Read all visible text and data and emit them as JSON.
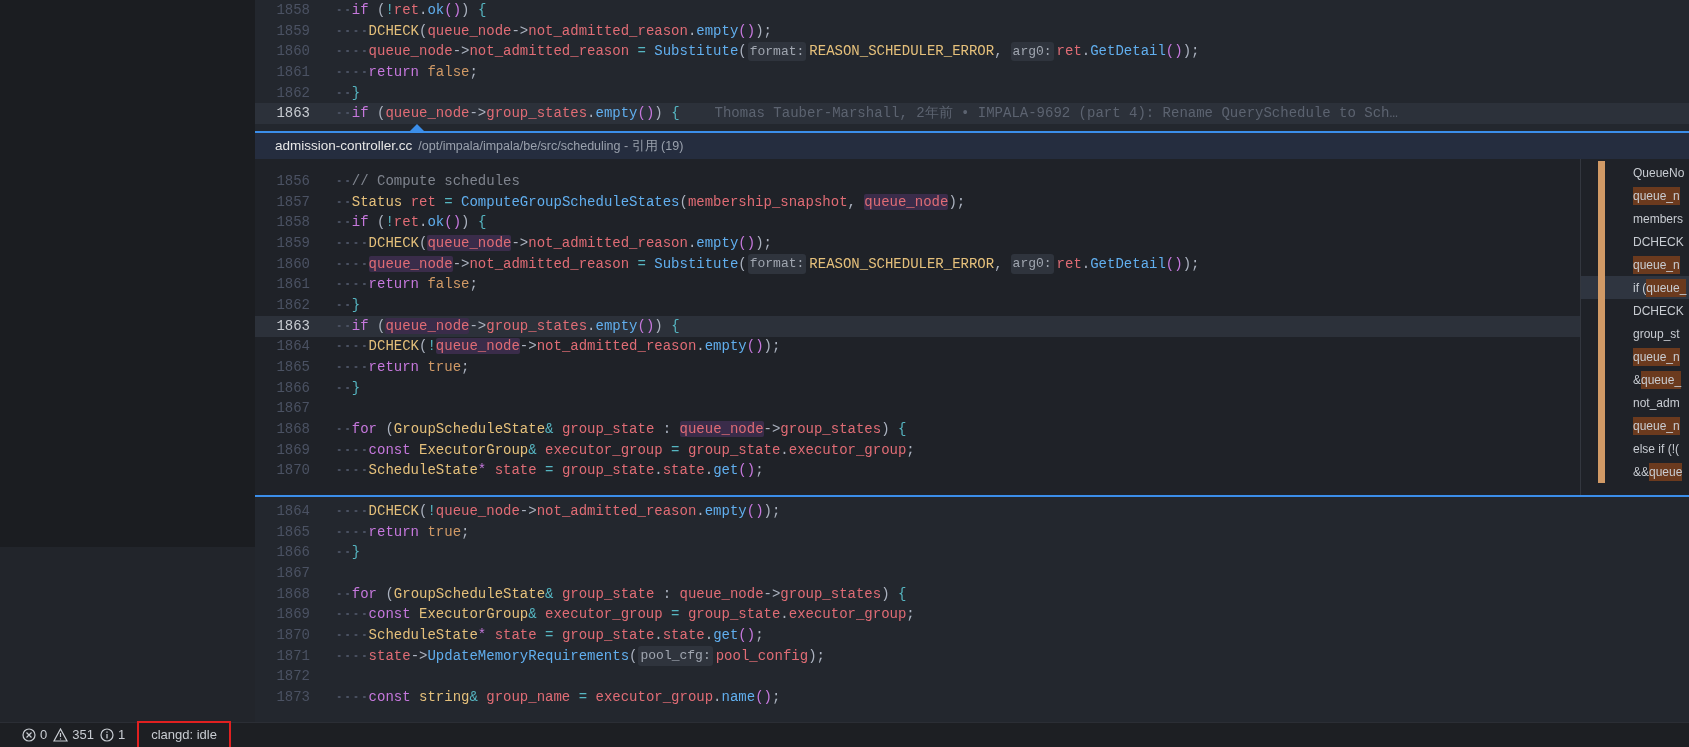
{
  "editor_top": {
    "lines": [
      {
        "number": "1858",
        "current": false,
        "segments": [
          {
            "kind": "code",
            "tokens": [
              {
                "text": "  if",
                "kind": "kw"
              },
              {
                "text": " (",
                "kind": "p"
              },
              {
                "text": "!",
                "kind": "op"
              },
              {
                "text": "ret",
                "kind": "var"
              },
              {
                "text": ".",
                "kind": "p"
              },
              {
                "text": "ok",
                "kind": "fn"
              },
              {
                "text": "()",
                "kind": "p2"
              },
              {
                "text": ")",
                "kind": "p"
              },
              {
                "text": " {",
                "kind": "b"
              }
            ]
          }
        ]
      },
      {
        "number": "1859",
        "current": false,
        "segments": [
          {
            "kind": "code",
            "tokens": [
              {
                "text": "    DCHECK",
                "kind": "mac"
              },
              {
                "text": "(",
                "kind": "p"
              },
              {
                "text": "queue_node",
                "kind": "var"
              },
              {
                "text": "->",
                "kind": "p"
              },
              {
                "text": "not_admitted_reason",
                "kind": "var"
              },
              {
                "text": ".",
                "kind": "p"
              },
              {
                "text": "empty",
                "kind": "fn"
              },
              {
                "text": "()",
                "kind": "p2"
              },
              {
                "text": ");",
                "kind": "p"
              }
            ]
          }
        ]
      },
      {
        "number": "1860",
        "current": false,
        "segments": [
          {
            "kind": "code",
            "tokens": [
              {
                "text": "    queue_node",
                "kind": "var"
              },
              {
                "text": "->",
                "kind": "p"
              },
              {
                "text": "not_admitted_reason",
                "kind": "var"
              },
              {
                "text": " = ",
                "kind": "op"
              },
              {
                "text": "Substitute",
                "kind": "fn"
              },
              {
                "text": "(",
                "kind": "p"
              }
            ]
          },
          {
            "kind": "hint",
            "text": "format:"
          },
          {
            "kind": "code",
            "tokens": [
              {
                "text": "REASON_SCHEDULER_ERROR",
                "kind": "type"
              },
              {
                "text": ",",
                "kind": "p"
              }
            ]
          },
          {
            "kind": "hint",
            "text": "arg0:"
          },
          {
            "kind": "code",
            "tokens": [
              {
                "text": "ret",
                "kind": "var"
              },
              {
                "text": ".",
                "kind": "p"
              },
              {
                "text": "GetDetail",
                "kind": "fn"
              },
              {
                "text": "()",
                "kind": "p2"
              },
              {
                "text": ");",
                "kind": "p"
              }
            ]
          }
        ]
      },
      {
        "number": "1861",
        "current": false,
        "segments": [
          {
            "kind": "code",
            "tokens": [
              {
                "text": "    return",
                "kind": "kw"
              },
              {
                "text": " false",
                "kind": "lit"
              },
              {
                "text": ";",
                "kind": "p"
              }
            ]
          }
        ]
      },
      {
        "number": "1862",
        "current": false,
        "segments": [
          {
            "kind": "code",
            "tokens": [
              {
                "text": "  }",
                "kind": "b"
              }
            ]
          }
        ]
      },
      {
        "number": "1863",
        "current": true,
        "segments": [
          {
            "kind": "code",
            "tokens": [
              {
                "text": "  if",
                "kind": "kw"
              },
              {
                "text": " (",
                "kind": "p"
              },
              {
                "text": "queue_node",
                "kind": "var"
              },
              {
                "text": "->",
                "kind": "p"
              },
              {
                "text": "group_states",
                "kind": "var"
              },
              {
                "text": ".",
                "kind": "p"
              },
              {
                "text": "empty",
                "kind": "fn"
              },
              {
                "text": "()",
                "kind": "p2"
              },
              {
                "text": ")",
                "kind": "p"
              },
              {
                "text": " {",
                "kind": "b"
              }
            ]
          }
        ],
        "blame": "Thomas Tauber-Marshall, 2年前 • IMPALA-9692 (part 4): Rename QuerySchedule to Sch…"
      }
    ]
  },
  "peek": {
    "file": "admission-controller.cc",
    "path": "/opt/impala/impala/be/src/scheduling - 引用 (19)",
    "lines": [
      {
        "number": "1856",
        "current": false,
        "segments": [
          {
            "kind": "code",
            "tokens": [
              {
                "text": "  // Compute schedules",
                "kind": "cm"
              }
            ]
          }
        ]
      },
      {
        "number": "1857",
        "current": false,
        "segments": [
          {
            "kind": "code",
            "tokens": [
              {
                "text": "  Status",
                "kind": "type"
              },
              {
                "text": " ret",
                "kind": "var"
              },
              {
                "text": " = ",
                "kind": "op"
              },
              {
                "text": "ComputeGroupScheduleStates",
                "kind": "fn"
              },
              {
                "text": "(",
                "kind": "p"
              },
              {
                "text": "membership_snapshot",
                "kind": "var"
              },
              {
                "text": ", ",
                "kind": "p"
              },
              {
                "text": "queue_node",
                "kind": "vhl"
              },
              {
                "text": ");",
                "kind": "p"
              }
            ]
          }
        ]
      },
      {
        "number": "1858",
        "current": false,
        "segments": [
          {
            "kind": "code",
            "tokens": [
              {
                "text": "  if",
                "kind": "kw"
              },
              {
                "text": " (",
                "kind": "p"
              },
              {
                "text": "!",
                "kind": "op"
              },
              {
                "text": "ret",
                "kind": "var"
              },
              {
                "text": ".",
                "kind": "p"
              },
              {
                "text": "ok",
                "kind": "fn"
              },
              {
                "text": "()",
                "kind": "p2"
              },
              {
                "text": ")",
                "kind": "p"
              },
              {
                "text": " {",
                "kind": "b"
              }
            ]
          }
        ]
      },
      {
        "number": "1859",
        "current": false,
        "segments": [
          {
            "kind": "code",
            "tokens": [
              {
                "text": "    DCHECK",
                "kind": "mac"
              },
              {
                "text": "(",
                "kind": "p"
              },
              {
                "text": "queue_node",
                "kind": "vhl"
              },
              {
                "text": "->",
                "kind": "p"
              },
              {
                "text": "not_admitted_reason",
                "kind": "var"
              },
              {
                "text": ".",
                "kind": "p"
              },
              {
                "text": "empty",
                "kind": "fn"
              },
              {
                "text": "()",
                "kind": "p2"
              },
              {
                "text": ");",
                "kind": "p"
              }
            ]
          }
        ]
      },
      {
        "number": "1860",
        "current": false,
        "segments": [
          {
            "kind": "code",
            "tokens": [
              {
                "text": "    queue_node",
                "kind": "vhl"
              },
              {
                "text": "->",
                "kind": "p"
              },
              {
                "text": "not_admitted_reason",
                "kind": "var"
              },
              {
                "text": " = ",
                "kind": "op"
              },
              {
                "text": "Substitute",
                "kind": "fn"
              },
              {
                "text": "(",
                "kind": "p"
              }
            ]
          },
          {
            "kind": "hint",
            "text": "format:"
          },
          {
            "kind": "code",
            "tokens": [
              {
                "text": "REASON_SCHEDULER_ERROR",
                "kind": "type"
              },
              {
                "text": ",",
                "kind": "p"
              }
            ]
          },
          {
            "kind": "hint",
            "text": "arg0:"
          },
          {
            "kind": "code",
            "tokens": [
              {
                "text": "ret",
                "kind": "var"
              },
              {
                "text": ".",
                "kind": "p"
              },
              {
                "text": "GetDetail",
                "kind": "fn"
              },
              {
                "text": "()",
                "kind": "p2"
              },
              {
                "text": ");",
                "kind": "p"
              }
            ]
          }
        ]
      },
      {
        "number": "1861",
        "current": false,
        "segments": [
          {
            "kind": "code",
            "tokens": [
              {
                "text": "    return",
                "kind": "kw"
              },
              {
                "text": " false",
                "kind": "lit"
              },
              {
                "text": ";",
                "kind": "p"
              }
            ]
          }
        ]
      },
      {
        "number": "1862",
        "current": false,
        "segments": [
          {
            "kind": "code",
            "tokens": [
              {
                "text": "  }",
                "kind": "b"
              }
            ]
          }
        ]
      },
      {
        "number": "1863",
        "current": true,
        "segments": [
          {
            "kind": "code",
            "tokens": [
              {
                "text": "  if",
                "kind": "kw"
              },
              {
                "text": " (",
                "kind": "p"
              },
              {
                "text": "queue_node",
                "kind": "vhl"
              },
              {
                "text": "->",
                "kind": "p"
              },
              {
                "text": "group_states",
                "kind": "var"
              },
              {
                "text": ".",
                "kind": "p"
              },
              {
                "text": "empty",
                "kind": "fn"
              },
              {
                "text": "()",
                "kind": "p2"
              },
              {
                "text": ")",
                "kind": "p"
              },
              {
                "text": " {",
                "kind": "b"
              }
            ]
          }
        ]
      },
      {
        "number": "1864",
        "current": false,
        "segments": [
          {
            "kind": "code",
            "tokens": [
              {
                "text": "    DCHECK",
                "kind": "mac"
              },
              {
                "text": "(",
                "kind": "p"
              },
              {
                "text": "!",
                "kind": "op"
              },
              {
                "text": "queue_node",
                "kind": "vhl"
              },
              {
                "text": "->",
                "kind": "p"
              },
              {
                "text": "not_admitted_reason",
                "kind": "var"
              },
              {
                "text": ".",
                "kind": "p"
              },
              {
                "text": "empty",
                "kind": "fn"
              },
              {
                "text": "()",
                "kind": "p2"
              },
              {
                "text": ");",
                "kind": "p"
              }
            ]
          }
        ]
      },
      {
        "number": "1865",
        "current": false,
        "segments": [
          {
            "kind": "code",
            "tokens": [
              {
                "text": "    return",
                "kind": "kw"
              },
              {
                "text": " true",
                "kind": "lit"
              },
              {
                "text": ";",
                "kind": "p"
              }
            ]
          }
        ]
      },
      {
        "number": "1866",
        "current": false,
        "segments": [
          {
            "kind": "code",
            "tokens": [
              {
                "text": "  }",
                "kind": "b"
              }
            ]
          }
        ]
      },
      {
        "number": "1867",
        "current": false
      },
      {
        "number": "1868",
        "current": false,
        "segments": [
          {
            "kind": "code",
            "tokens": [
              {
                "text": "  for",
                "kind": "kw"
              },
              {
                "text": " (",
                "kind": "p"
              },
              {
                "text": "GroupScheduleState",
                "kind": "type"
              },
              {
                "text": "&",
                "kind": "op"
              },
              {
                "text": " group_state",
                "kind": "var"
              },
              {
                "text": " : ",
                "kind": "p"
              },
              {
                "text": "queue_node",
                "kind": "vhl"
              },
              {
                "text": "->",
                "kind": "p"
              },
              {
                "text": "group_states",
                "kind": "var"
              },
              {
                "text": ")",
                "kind": "p"
              },
              {
                "text": " {",
                "kind": "b"
              }
            ]
          }
        ]
      },
      {
        "number": "1869",
        "current": false,
        "segments": [
          {
            "kind": "code",
            "tokens": [
              {
                "text": "    const",
                "kind": "kw"
              },
              {
                "text": " ExecutorGroup",
                "kind": "type"
              },
              {
                "text": "&",
                "kind": "op"
              },
              {
                "text": " executor_group",
                "kind": "var"
              },
              {
                "text": " = ",
                "kind": "op"
              },
              {
                "text": "group_state",
                "kind": "var"
              },
              {
                "text": ".",
                "kind": "p"
              },
              {
                "text": "executor_group",
                "kind": "var"
              },
              {
                "text": ";",
                "kind": "p"
              }
            ]
          }
        ]
      },
      {
        "number": "1870",
        "current": false,
        "segments": [
          {
            "kind": "code",
            "tokens": [
              {
                "text": "    ScheduleState",
                "kind": "type"
              },
              {
                "text": "*",
                "kind": "kw"
              },
              {
                "text": " state",
                "kind": "var"
              },
              {
                "text": " = ",
                "kind": "op"
              },
              {
                "text": "group_state",
                "kind": "var"
              },
              {
                "text": ".",
                "kind": "p"
              },
              {
                "text": "state",
                "kind": "var"
              },
              {
                "text": ".",
                "kind": "p"
              },
              {
                "text": "get",
                "kind": "fn"
              },
              {
                "text": "()",
                "kind": "p2"
              },
              {
                "text": ";",
                "kind": "p"
              }
            ]
          }
        ]
      }
    ],
    "references": [
      {
        "before": "QueueNo",
        "selected": false
      },
      {
        "match": "queue_n",
        "selected": false
      },
      {
        "before": "members",
        "selected": false
      },
      {
        "before": "DCHECK",
        "selected": false
      },
      {
        "match": "queue_n",
        "selected": false
      },
      {
        "before": "if (",
        "match": "queue_",
        "selected": true
      },
      {
        "before": "DCHECK",
        "selected": false
      },
      {
        "before": "group_st",
        "selected": false
      },
      {
        "match": "queue_n",
        "selected": false
      },
      {
        "before": "&",
        "match": "queue_",
        "selected": false
      },
      {
        "before": "not_adm",
        "selected": false
      },
      {
        "match": "queue_n",
        "selected": false
      },
      {
        "before": "else if (!(",
        "selected": false
      },
      {
        "before": "&&",
        "match": "queue",
        "selected": false
      }
    ]
  },
  "editor_bottom": {
    "lines": [
      {
        "number": "1864",
        "current": false,
        "segments": [
          {
            "kind": "code",
            "tokens": [
              {
                "text": "    DCHECK",
                "kind": "mac"
              },
              {
                "text": "(",
                "kind": "p"
              },
              {
                "text": "!",
                "kind": "op"
              },
              {
                "text": "queue_node",
                "kind": "var"
              },
              {
                "text": "->",
                "kind": "p"
              },
              {
                "text": "not_admitted_reason",
                "kind": "var"
              },
              {
                "text": ".",
                "kind": "p"
              },
              {
                "text": "empty",
                "kind": "fn"
              },
              {
                "text": "()",
                "kind": "p2"
              },
              {
                "text": ");",
                "kind": "p"
              }
            ]
          }
        ]
      },
      {
        "number": "1865",
        "current": false,
        "segments": [
          {
            "kind": "code",
            "tokens": [
              {
                "text": "    return",
                "kind": "kw"
              },
              {
                "text": " true",
                "kind": "lit"
              },
              {
                "text": ";",
                "kind": "p"
              }
            ]
          }
        ]
      },
      {
        "number": "1866",
        "current": false,
        "segments": [
          {
            "kind": "code",
            "tokens": [
              {
                "text": "  }",
                "kind": "b"
              }
            ]
          }
        ]
      },
      {
        "number": "1867",
        "current": false
      },
      {
        "number": "1868",
        "current": false,
        "segments": [
          {
            "kind": "code",
            "tokens": [
              {
                "text": "  for",
                "kind": "kw"
              },
              {
                "text": " (",
                "kind": "p"
              },
              {
                "text": "GroupScheduleState",
                "kind": "type"
              },
              {
                "text": "&",
                "kind": "op"
              },
              {
                "text": " group_state",
                "kind": "var"
              },
              {
                "text": " : ",
                "kind": "p"
              },
              {
                "text": "queue_node",
                "kind": "var"
              },
              {
                "text": "->",
                "kind": "p"
              },
              {
                "text": "group_states",
                "kind": "var"
              },
              {
                "text": ")",
                "kind": "p"
              },
              {
                "text": " {",
                "kind": "b"
              }
            ]
          }
        ]
      },
      {
        "number": "1869",
        "current": false,
        "segments": [
          {
            "kind": "code",
            "tokens": [
              {
                "text": "    const",
                "kind": "kw"
              },
              {
                "text": " ExecutorGroup",
                "kind": "type"
              },
              {
                "text": "&",
                "kind": "op"
              },
              {
                "text": " executor_group",
                "kind": "var"
              },
              {
                "text": " = ",
                "kind": "op"
              },
              {
                "text": "group_state",
                "kind": "var"
              },
              {
                "text": ".",
                "kind": "p"
              },
              {
                "text": "executor_group",
                "kind": "var"
              },
              {
                "text": ";",
                "kind": "p"
              }
            ]
          }
        ]
      },
      {
        "number": "1870",
        "current": false,
        "segments": [
          {
            "kind": "code",
            "tokens": [
              {
                "text": "    ScheduleState",
                "kind": "type"
              },
              {
                "text": "*",
                "kind": "kw"
              },
              {
                "text": " state",
                "kind": "var"
              },
              {
                "text": " = ",
                "kind": "op"
              },
              {
                "text": "group_state",
                "kind": "var"
              },
              {
                "text": ".",
                "kind": "p"
              },
              {
                "text": "state",
                "kind": "var"
              },
              {
                "text": ".",
                "kind": "p"
              },
              {
                "text": "get",
                "kind": "fn"
              },
              {
                "text": "()",
                "kind": "p2"
              },
              {
                "text": ";",
                "kind": "p"
              }
            ]
          }
        ]
      },
      {
        "number": "1871",
        "current": false,
        "segments": [
          {
            "kind": "code",
            "tokens": [
              {
                "text": "    state",
                "kind": "var"
              },
              {
                "text": "->",
                "kind": "p"
              },
              {
                "text": "UpdateMemoryRequirements",
                "kind": "fn"
              },
              {
                "text": "(",
                "kind": "p"
              }
            ]
          },
          {
            "kind": "hint",
            "text": "pool_cfg:"
          },
          {
            "kind": "code",
            "tokens": [
              {
                "text": "pool_config",
                "kind": "var"
              },
              {
                "text": ");",
                "kind": "p"
              }
            ]
          }
        ]
      },
      {
        "number": "1872",
        "current": false
      },
      {
        "number": "1873",
        "current": false,
        "segments": [
          {
            "kind": "code",
            "tokens": [
              {
                "text": "    const",
                "kind": "kw"
              },
              {
                "text": " string",
                "kind": "type"
              },
              {
                "text": "&",
                "kind": "op"
              },
              {
                "text": " group_name",
                "kind": "var"
              },
              {
                "text": " = ",
                "kind": "op"
              },
              {
                "text": "executor_group",
                "kind": "var"
              },
              {
                "text": ".",
                "kind": "p"
              },
              {
                "text": "name",
                "kind": "fn"
              },
              {
                "text": "()",
                "kind": "p2"
              },
              {
                "text": ";",
                "kind": "p"
              }
            ]
          }
        ]
      }
    ]
  },
  "status_bar": {
    "items": [
      {
        "kind": "errors",
        "text": "0"
      },
      {
        "kind": "warnings",
        "text": "351"
      },
      {
        "kind": "info",
        "text": "1"
      },
      {
        "kind": "server",
        "text": "clangd: idle",
        "outlined": true
      }
    ]
  }
}
